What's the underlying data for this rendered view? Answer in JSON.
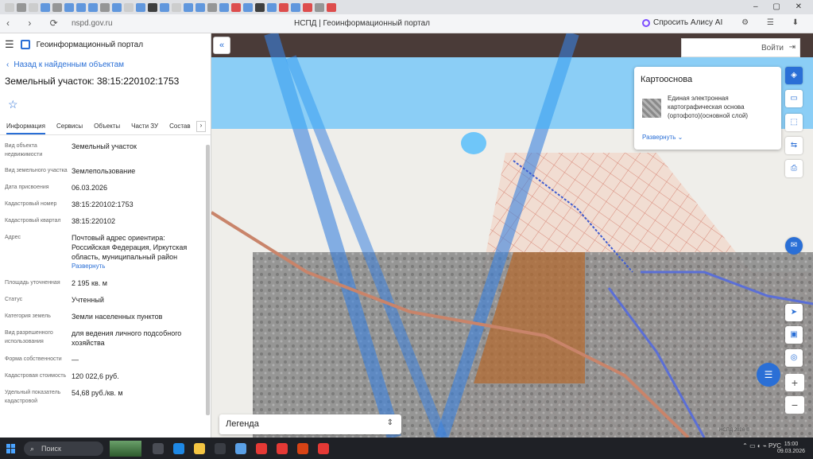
{
  "browser": {
    "url": "nspd.gov.ru",
    "page_title": "НСПД | Геоинформационный портал",
    "alice_label": "Спросить Алису AI"
  },
  "portal": {
    "title": "Геоинформационный портал",
    "back_link": "Назад к найденным объектам",
    "object_title": "Земельный участок: 38:15:220102:1753",
    "tabs": [
      "Информация",
      "Сервисы",
      "Объекты",
      "Части ЗУ",
      "Состав"
    ],
    "more_glyph": "›",
    "fields": [
      {
        "key": "Вид объекта недвижимости",
        "value": "Земельный участок"
      },
      {
        "key": "Вид земельного участка",
        "value": "Землепользование"
      },
      {
        "key": "Дата присвоения",
        "value": "06.03.2026"
      },
      {
        "key": "Кадастровый номер",
        "value": "38:15:220102:1753"
      },
      {
        "key": "Кадастровый квартал",
        "value": "38:15:220102"
      },
      {
        "key": "Адрес",
        "value": "Почтовый адрес ориентира: Российская Федерация, Иркутская область, муниципальный район",
        "expand": "Развернуть"
      },
      {
        "key": "Площадь уточненная",
        "value": "2 195 кв. м"
      },
      {
        "key": "Статус",
        "value": "Учтенный"
      },
      {
        "key": "Категория земель",
        "value": "Земли населенных пунктов"
      },
      {
        "key": "Вид разрешенного использования",
        "value": "для ведения личного подсобного хозяйства"
      },
      {
        "key": "Форма собственности",
        "value": "—"
      },
      {
        "key": "Кадастровая стоимость",
        "value": "120 022,6 руб."
      },
      {
        "key": "Удельный показатель кадастровой",
        "value": "54,68 руб./кв. м"
      }
    ]
  },
  "map": {
    "login_label": "Войти",
    "basemap_title": "Картооснова",
    "basemap_desc": "Единая электронная картографическая основа (ортофото)(основной слой)",
    "basemap_expand": "Развернуть",
    "legend_label": "Легенда",
    "copyright": "НСПД 2026 ©"
  },
  "taskbar": {
    "search_label": "Поиск",
    "lang": "РУС",
    "time": "15:00",
    "date": "09.03.2026"
  },
  "colors": {
    "accent": "#2a6fd6",
    "highlight_band": "#39b5ff",
    "parcel_lines": "#e07a6a"
  }
}
